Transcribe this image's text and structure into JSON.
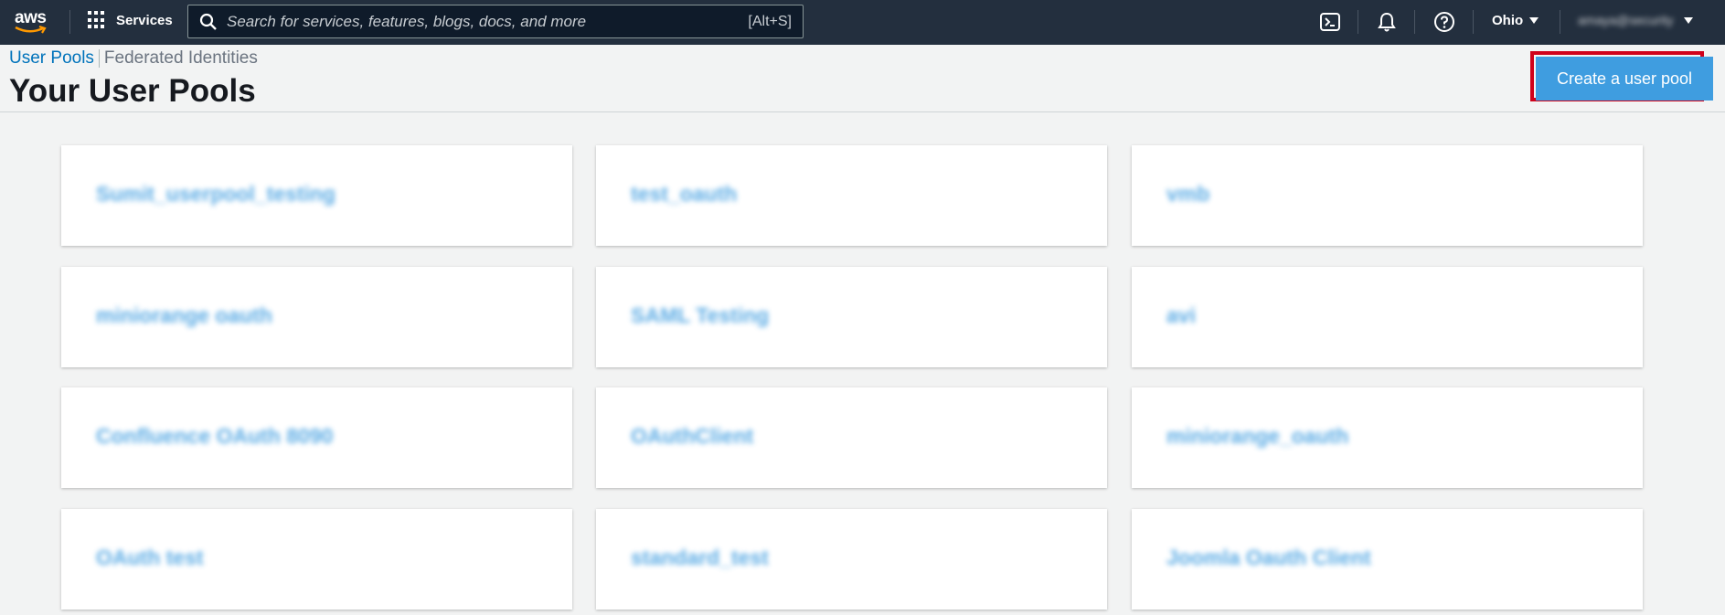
{
  "topnav": {
    "logo_text": "aws",
    "services_label": "Services",
    "search_placeholder": "Search for services, features, blogs, docs, and more",
    "search_shortcut": "[Alt+S]",
    "region_label": "Ohio",
    "account_label": "amaya@security"
  },
  "breadcrumb": {
    "user_pools": "User Pools",
    "federated_identities": "Federated Identities"
  },
  "page_title": "Your User Pools",
  "create_button_label": "Create a user pool",
  "pools": [
    "Sumit_userpool_testing",
    "test_oauth",
    "vmb",
    "miniorange oauth",
    "SAML Testing",
    "avi",
    "Confluence OAuth 8090",
    "OAuthClient",
    "miniorange_oauth",
    "OAuth test",
    "standard_test",
    "Joomla Oauth Client"
  ],
  "colors": {
    "nav_bg": "#232f3e",
    "link_blue": "#0073bb",
    "button_blue": "#3f9de0",
    "highlight_red": "#d0021b",
    "page_bg": "#f2f3f3"
  }
}
